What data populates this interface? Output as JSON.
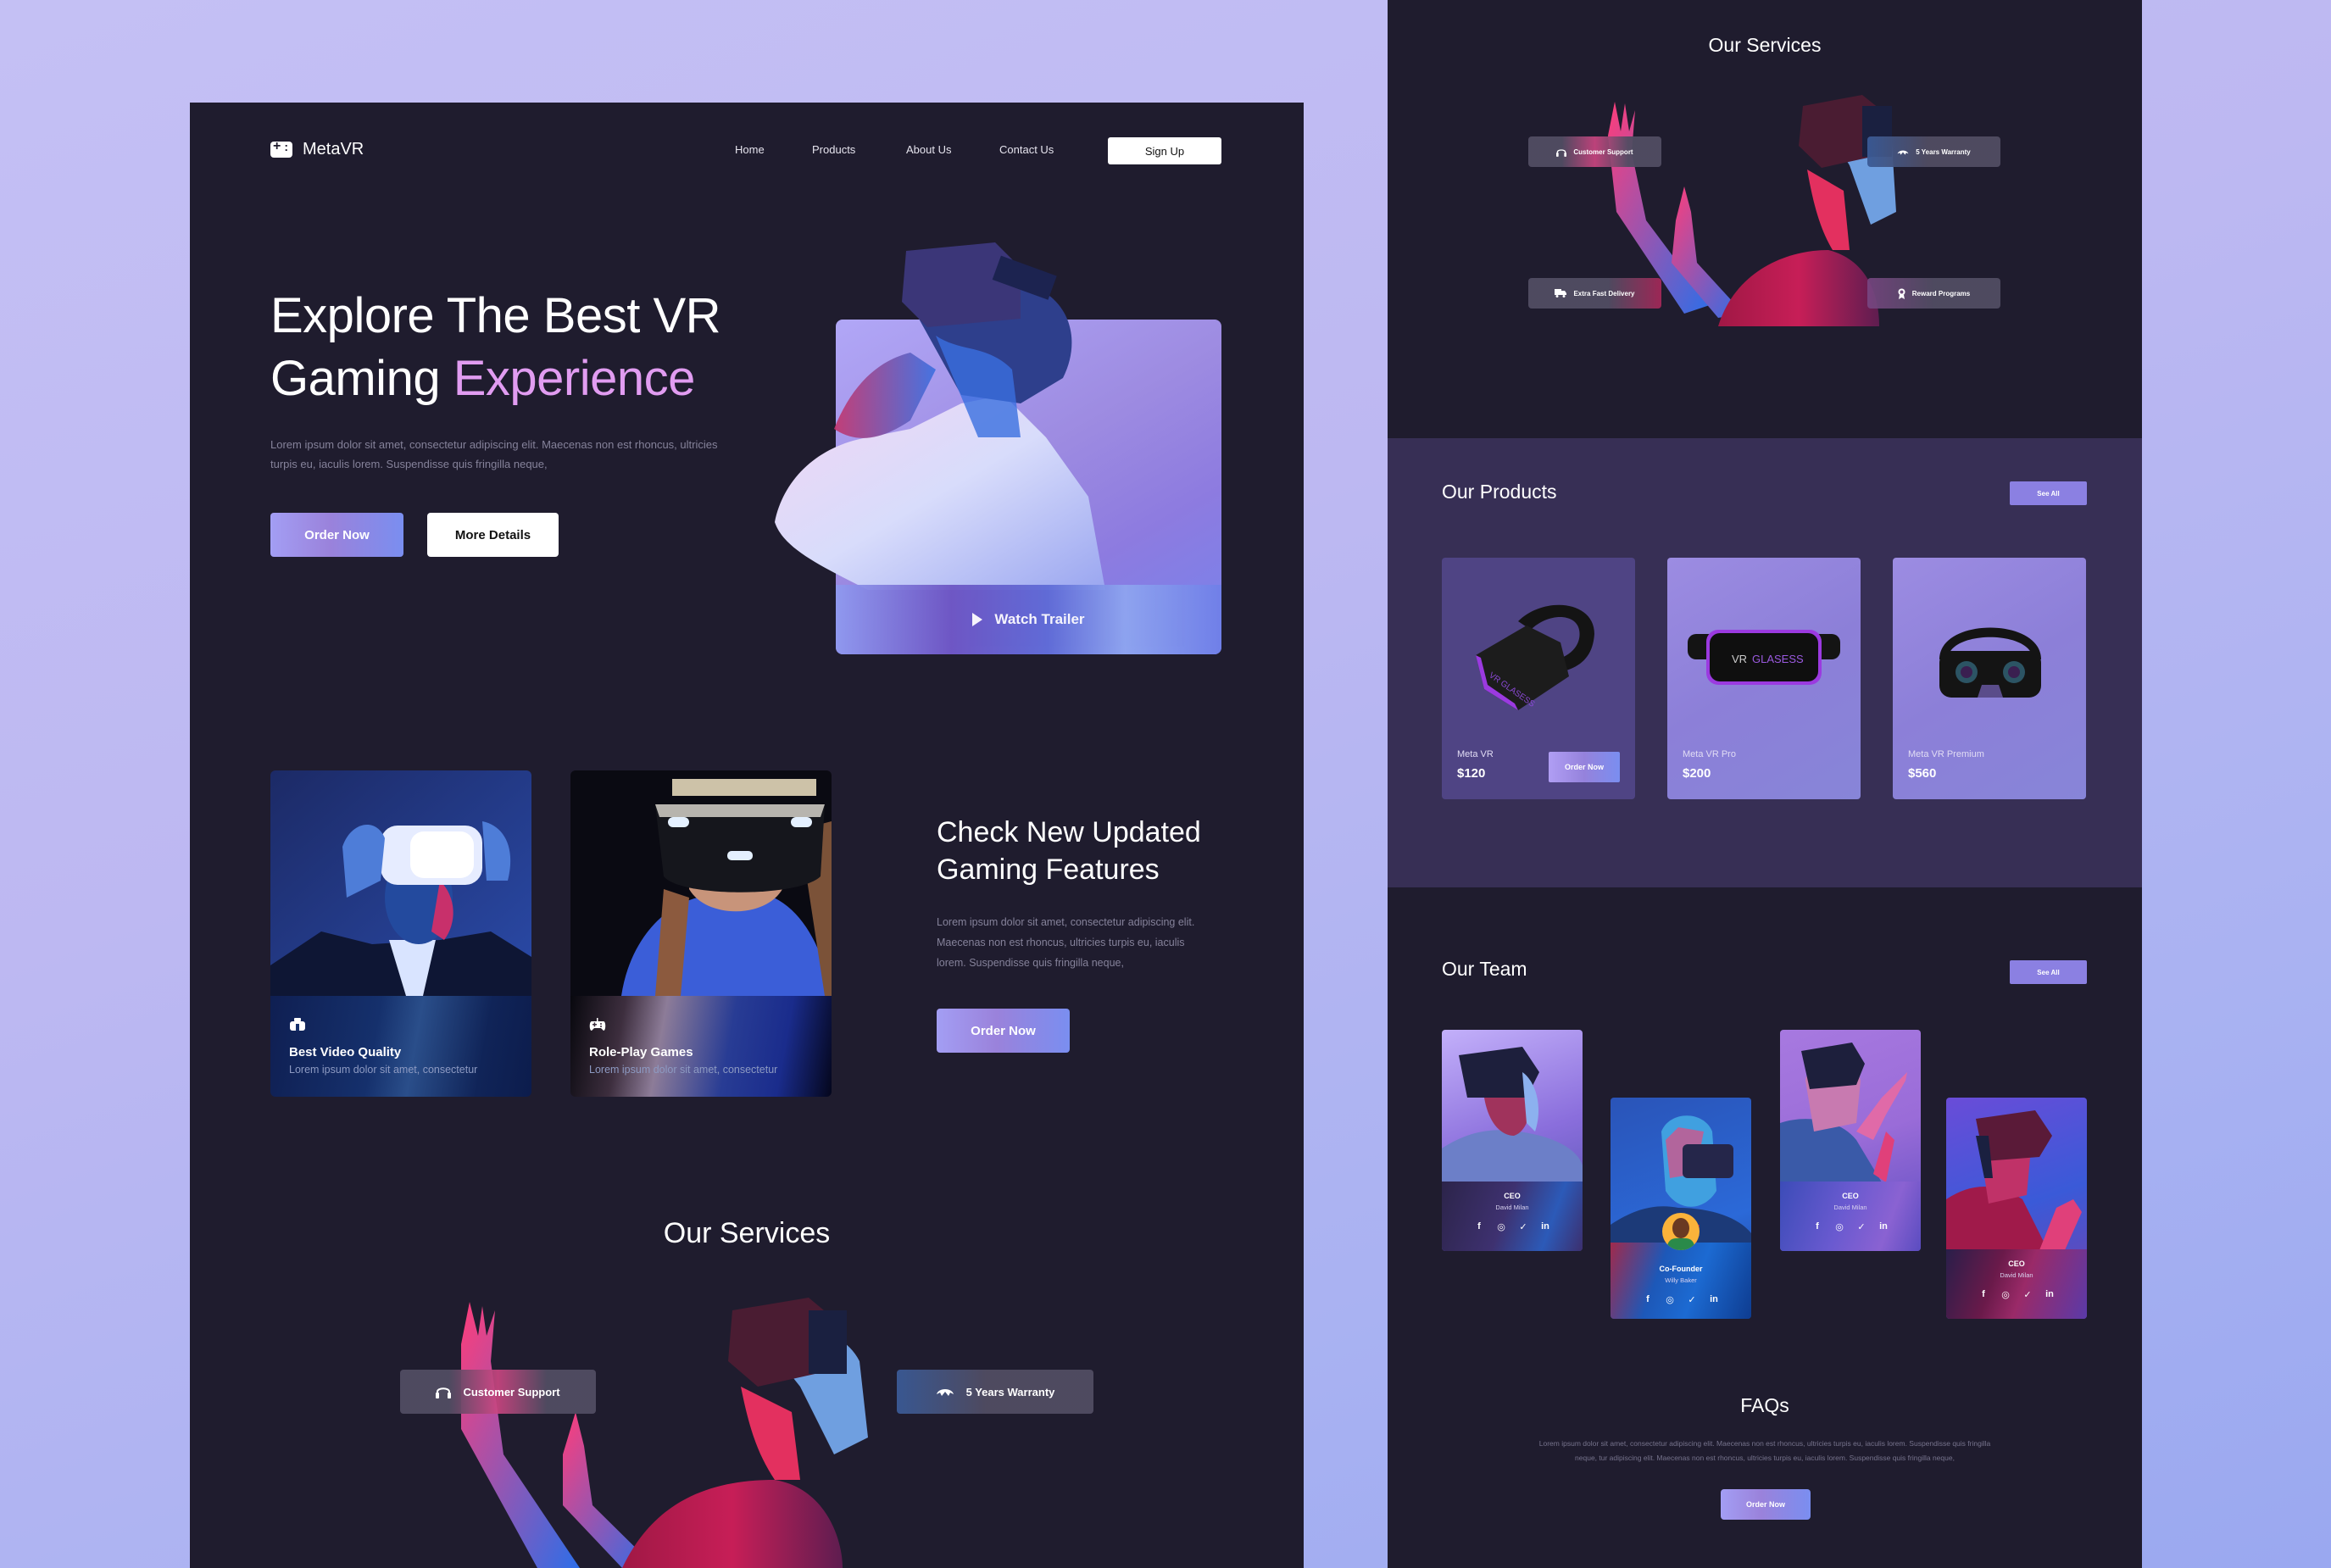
{
  "colors": {
    "page_bg_top": "#c4c0f4",
    "panel_bg": "#1f1c2e",
    "products_bg": "#372f55",
    "accent_pink": "#e19cf1",
    "button_purple": "#8b80e2"
  },
  "landing": {
    "brand": {
      "name": "MetaVR",
      "icon": "gamepad-icon"
    },
    "nav": {
      "links": [
        "Home",
        "Products",
        "About Us",
        "Contact Us"
      ],
      "signup_label": "Sign Up"
    },
    "hero": {
      "title_line1": "Explore The Best VR",
      "title_line2_plain": "Gaming ",
      "title_line2_accent": "Experience",
      "paragraph": "Lorem ipsum dolor sit amet, consectetur adipiscing elit. Maecenas non est rhoncus, ultricies turpis eu, iaculis lorem. Suspendisse quis fringilla neque,",
      "order_label": "Order Now",
      "details_label": "More Details",
      "trailer_label": "Watch Trailer",
      "trailer_icon": "play-icon"
    },
    "features": {
      "cards": [
        {
          "icon": "vr-headset-icon",
          "title": "Best Video Quality",
          "subtitle": "Lorem ipsum dolor sit amet, consectetur"
        },
        {
          "icon": "gamepad-icon",
          "title": "Role-Play Games",
          "subtitle": "Lorem ipsum dolor sit amet, consectetur"
        }
      ],
      "title_line1": "Check New Updated",
      "title_line2": "Gaming Features",
      "paragraph": "Lorem ipsum dolor sit amet, consectetur adipiscing elit. Maecenas non est rhoncus, ultricies turpis eu, iaculis lorem. Suspendisse quis fringilla neque,",
      "order_label": "Order Now"
    },
    "services": {
      "title": "Our Services",
      "pills": [
        {
          "icon": "headphones-icon",
          "label": "Customer Support"
        },
        {
          "icon": "warranty-icon",
          "label": "5 Years Warranty"
        }
      ]
    }
  },
  "mobile": {
    "services": {
      "title": "Our Services",
      "pills": [
        {
          "icon": "headphones-icon",
          "label": "Customer Support"
        },
        {
          "icon": "warranty-icon",
          "label": "5 Years Warranty"
        },
        {
          "icon": "truck-icon",
          "label": "Extra Fast Delivery"
        },
        {
          "icon": "award-icon",
          "label": "Reward Programs"
        }
      ]
    },
    "products": {
      "title": "Our Products",
      "see_all_label": "See All",
      "items": [
        {
          "name": "Meta VR",
          "price": "$120",
          "order_label": "Order Now"
        },
        {
          "name": "Meta VR Pro",
          "price": "$200",
          "visor_text_1": "VR",
          "visor_text_2": "GLASESS"
        },
        {
          "name": "Meta VR Premium",
          "price": "$560"
        }
      ]
    },
    "team": {
      "title": "Our Team",
      "see_all_label": "See All",
      "members": [
        {
          "role": "CEO",
          "name": "David Milan"
        },
        {
          "role": "Co-Founder",
          "name": "Willy Baker"
        },
        {
          "role": "CEO",
          "name": "David Milan"
        },
        {
          "role": "CEO",
          "name": "David Milan"
        }
      ],
      "social": [
        "f",
        "◎",
        "🐦",
        "in"
      ]
    },
    "faq": {
      "title": "FAQs",
      "paragraph": "Lorem ipsum dolor sit amet, consectetur adipiscing elit. Maecenas non est rhoncus, ultricies turpis eu, iaculis lorem. Suspendisse quis fringilla neque, tur adipiscing elit. Maecenas non est rhoncus, ultricies turpis eu, iaculis lorem. Suspendisse quis fringilla neque,",
      "order_label": "Order Now"
    }
  }
}
